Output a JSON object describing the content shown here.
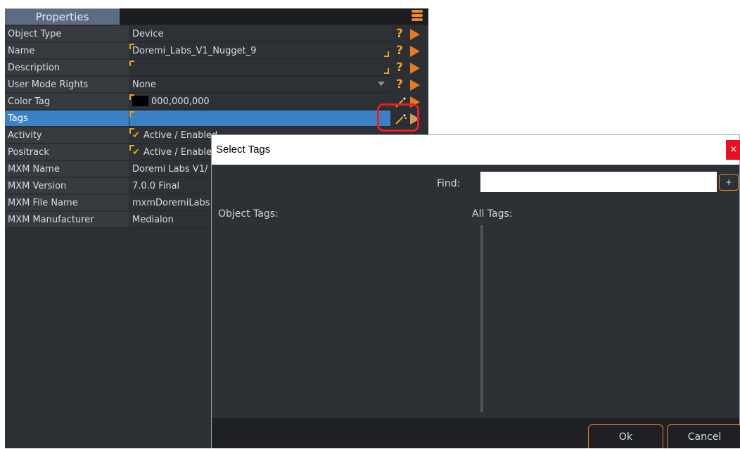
{
  "properties": {
    "tab_label": "Properties",
    "rows": [
      {
        "label": "Object Type",
        "value": "Device"
      },
      {
        "label": "Name",
        "value": "Doremi_Labs_V1_Nugget_9"
      },
      {
        "label": "Description",
        "value": ""
      },
      {
        "label": "User Mode Rights",
        "value": "None"
      },
      {
        "label": "Color Tag",
        "value": "000,000,000"
      },
      {
        "label": "Tags",
        "value": ""
      },
      {
        "label": "Activity",
        "value": "Active / Enabled"
      },
      {
        "label": "Positrack",
        "value": "Active / Enabled"
      },
      {
        "label": "MXM Name",
        "value": "Doremi Labs V1/"
      },
      {
        "label": "MXM Version",
        "value": "7.0.0 Final"
      },
      {
        "label": "MXM File Name",
        "value": "mxmDoremiLabs"
      },
      {
        "label": "MXM Manufacturer",
        "value": "Medialon"
      }
    ],
    "help_glyph": "?",
    "check_glyph": "✔"
  },
  "dialog": {
    "title": "Select Tags",
    "close_label": "×",
    "find_label": "Find:",
    "find_value": "",
    "add_label": "+",
    "object_tags_label": "Object Tags:",
    "all_tags_label": "All Tags:",
    "ok_label": "Ok",
    "cancel_label": "Cancel"
  },
  "colors": {
    "accent": "#f0a020",
    "selection": "#3a82c4",
    "highlight_ring": "#ec1c24",
    "close_red": "#e81123"
  }
}
